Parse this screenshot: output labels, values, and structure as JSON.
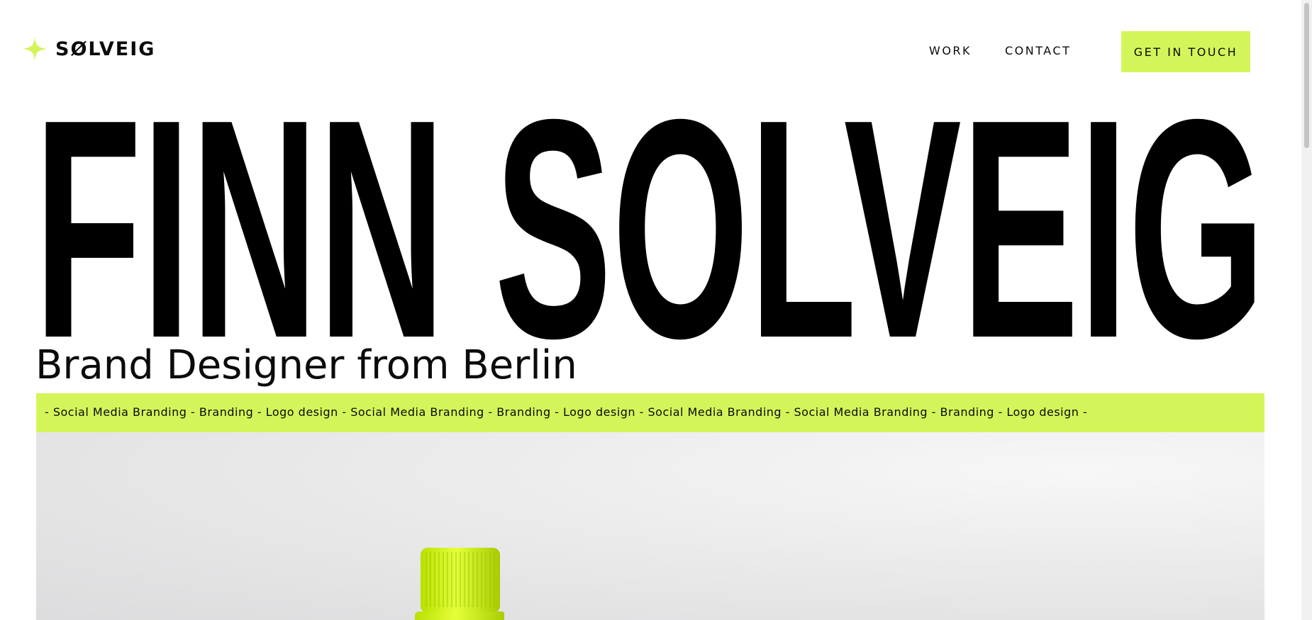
{
  "brand": {
    "name": "SØLVEIG",
    "icon": "sparkle-star-icon"
  },
  "nav": {
    "work": "WORK",
    "contact": "CONTACT",
    "cta": "GET IN TOUCH"
  },
  "hero": {
    "name": "FINN SOLVEIG",
    "subtitle": "Brand Designer from Berlin"
  },
  "ticker": {
    "text": "- Social Media Branding - Branding - Logo design - Social Media Branding - Branding - Logo design - Social Media Branding - Social Media Branding - Branding - Logo design -"
  },
  "colors": {
    "accent": "#d4f55a",
    "text": "#0b0b0b",
    "background": "#ffffff"
  }
}
